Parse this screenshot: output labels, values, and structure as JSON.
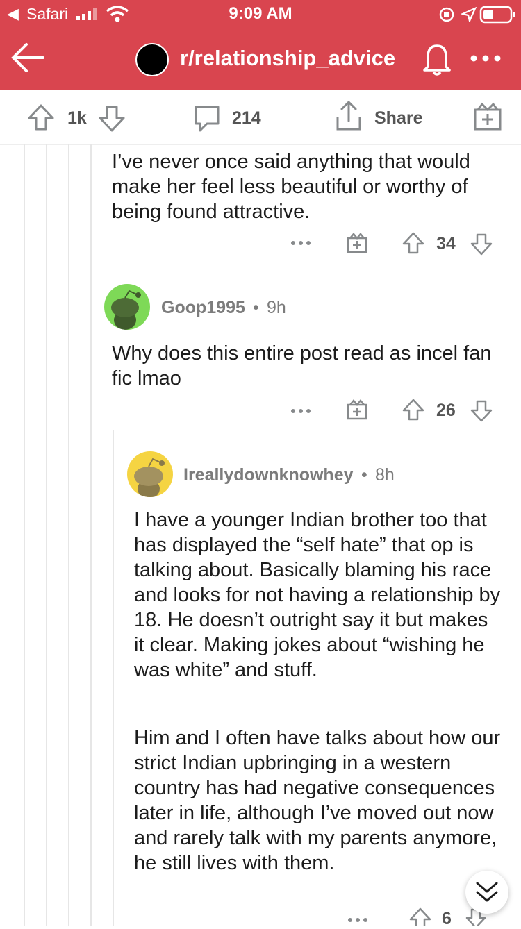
{
  "status_bar": {
    "carrier": "Safari",
    "time": "9:09 AM"
  },
  "header": {
    "subreddit": "r/relationship_advice"
  },
  "post_actions": {
    "upvotes": "1k",
    "comments": "214",
    "share_label": "Share"
  },
  "comments": [
    {
      "text": "I’ve never once said anything that would make her feel less beautiful or worthy of being found attractive.",
      "score": "34"
    },
    {
      "author": "Goop1995",
      "age": "9h",
      "text": "Why does this entire post read as incel fan fic lmao",
      "score": "26",
      "avatar_color": "#7ed957"
    },
    {
      "author": "Ireallydownknowhey",
      "age": "8h",
      "paragraph1": "I have a younger Indian brother too that has displayed the “self hate” that op is talking about. Basically blaming his race and looks for not having a relationship by 18.  He doesn’t outright say it but makes it clear. Making jokes about “wishing he was white” and stuff.",
      "paragraph2": "Him and I often have talks about how our strict Indian upbringing in a western country has had negative consequences later in life, although I’ve moved out now and rarely talk with my parents anymore, he still lives with them.",
      "score": "6",
      "avatar_color": "#f5d442"
    }
  ],
  "colors": {
    "brand": "#d9454f"
  },
  "icons": [
    "back-arrow-icon",
    "bell-icon",
    "more-icon",
    "upvote-icon",
    "downvote-icon",
    "comment-icon",
    "share-icon",
    "award-icon",
    "collapse-icon"
  ]
}
